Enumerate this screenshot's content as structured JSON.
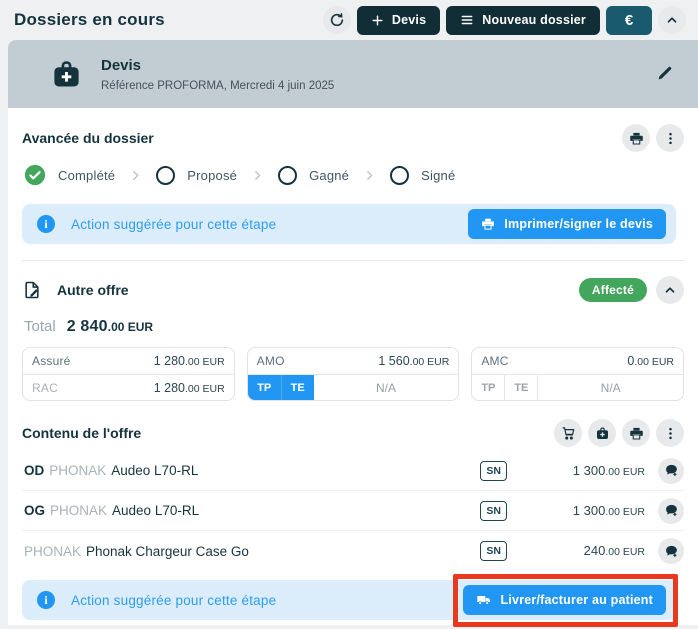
{
  "topbar": {
    "title": "Dossiers en cours",
    "buttons": [
      {
        "label": "Devis",
        "icon": "plus-icon"
      },
      {
        "label": "Nouveau dossier",
        "icon": "menu-icon"
      },
      {
        "label": "€",
        "icon": "euro-symbol"
      }
    ]
  },
  "devis_header": {
    "title": "Devis",
    "subtitle": "Référence PROFORMA, Mercredi 4 juin 2025"
  },
  "progress": {
    "title": "Avancée du dossier",
    "steps": [
      {
        "label": "Complété",
        "done": true
      },
      {
        "label": "Proposé",
        "done": false
      },
      {
        "label": "Gagné",
        "done": false
      },
      {
        "label": "Signé",
        "done": false
      }
    ]
  },
  "suggestion_top": {
    "text": "Action suggérée pour cette étape",
    "button_label": "Imprimer/signer le devis"
  },
  "offer": {
    "title": "Autre offre",
    "status_badge": "Affecté",
    "total_label": "Total",
    "total_amount": "2 840",
    "total_fraction": ".00 EUR",
    "boxes": [
      {
        "rows": [
          {
            "label": "Assuré",
            "amount": "1 280",
            "fraction": ".00 EUR"
          },
          {
            "label": "RAC",
            "amount": "1 280",
            "fraction": ".00 EUR"
          }
        ]
      },
      {
        "label": "AMO",
        "amount": "1 560",
        "fraction": ".00 EUR",
        "tp": "TP",
        "te": "TE",
        "na": "N/A",
        "active": true
      },
      {
        "label": "AMC",
        "amount": "0",
        "fraction": ".00 EUR",
        "tp": "TP",
        "te": "TE",
        "na": "N/A",
        "active": false
      }
    ]
  },
  "content": {
    "title": "Contenu de l'offre",
    "items": [
      {
        "side": "OD",
        "brand": "PHONAK",
        "name": "Audeo L70-RL",
        "sn": "SN",
        "amount": "1 300",
        "fraction": ".00 EUR"
      },
      {
        "side": "OG",
        "brand": "PHONAK",
        "name": "Audeo L70-RL",
        "sn": "SN",
        "amount": "1 300",
        "fraction": ".00 EUR"
      },
      {
        "side": "",
        "brand": "PHONAK",
        "name": "Phonak Chargeur Case Go",
        "sn": "SN",
        "amount": "240",
        "fraction": ".00 EUR"
      }
    ]
  },
  "suggestion_bottom": {
    "text": "Action suggérée pour cette étape",
    "button_label": "Livrer/facturer au patient"
  },
  "icons": [
    "refresh-icon",
    "plus-icon",
    "menu-icon",
    "chevron-up-icon",
    "medical-bag-icon",
    "pencil-icon",
    "printer-icon",
    "kebab-menu-icon",
    "check-circle-icon",
    "chevron-right-icon",
    "info-icon",
    "document-edit-icon",
    "cart-icon",
    "comment-add-icon",
    "truck-icon"
  ],
  "colors": {
    "navy": "#15333C",
    "dark_button": "#112D35",
    "teal_button": "#1A5A6E",
    "accent_blue": "#2196F3",
    "suggestion_bg": "#DBEDFB",
    "green": "#43A65C",
    "header_gray": "#C2CCD3",
    "annotation_red": "#E8391F"
  }
}
